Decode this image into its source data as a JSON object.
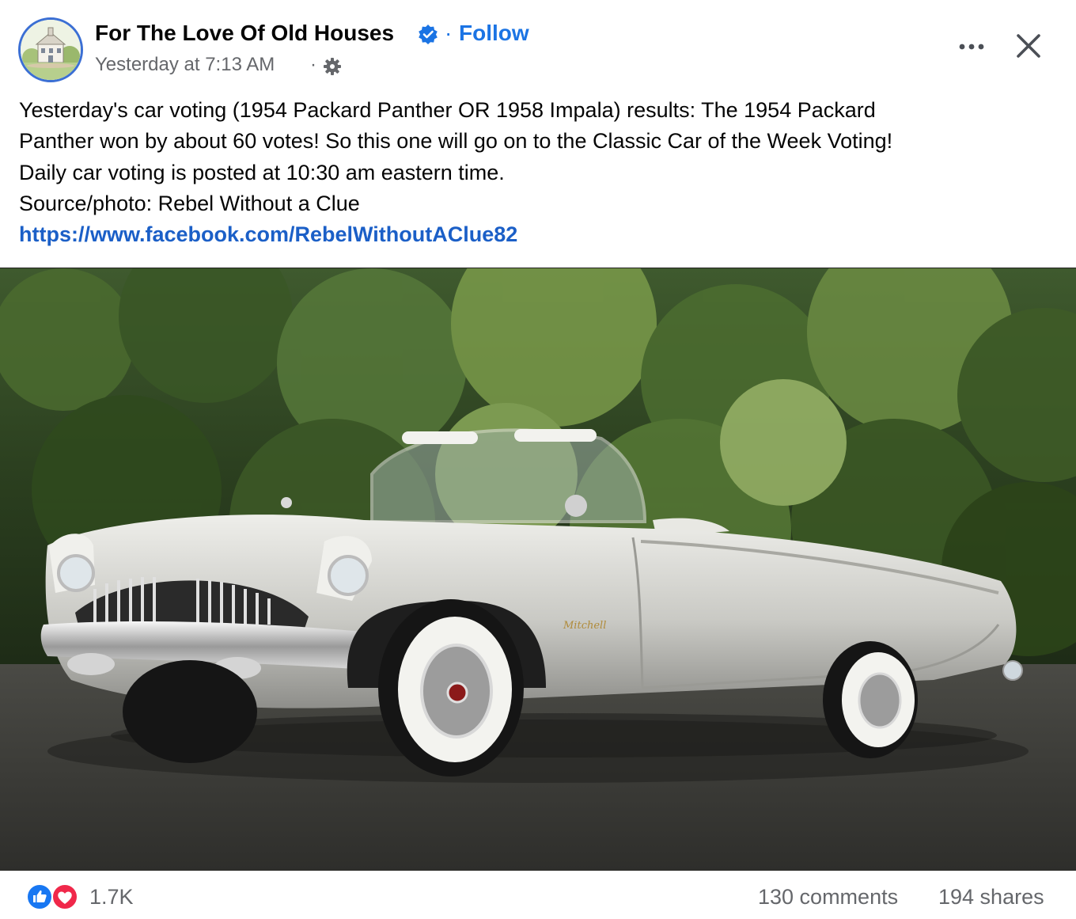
{
  "post": {
    "page_name": "For The Love Of Old Houses",
    "follow_label": "Follow",
    "separator": "·",
    "timestamp": "Yesterday at 7:13 AM",
    "text_lines": [
      "Yesterday's car voting (1954 Packard Panther OR 1958 Impala) results: The 1954 Packard",
      "Panther  won by about 60 votes! So this one will go on to the Classic Car of the Week Voting!",
      "Daily car voting is posted at 10:30 am eastern time.",
      "Source/photo: Rebel Without a Clue"
    ],
    "link": "https://www.facebook.com/RebelWithoutAClue82",
    "photo_script": "Mitchell"
  },
  "icons": {
    "verified": "verified-badge-icon",
    "audience": "gear-icon",
    "more": "more-options-icon",
    "close": "close-icon",
    "like": "like-icon",
    "love": "love-icon"
  },
  "colors": {
    "link_blue": "#1b74e4",
    "secondary_text": "#65676b",
    "like_blue": "#1877f2",
    "love_red": "#f0284a"
  },
  "stats": {
    "reactions": "1.7K",
    "comments": "130 comments",
    "shares": "194 shares"
  }
}
